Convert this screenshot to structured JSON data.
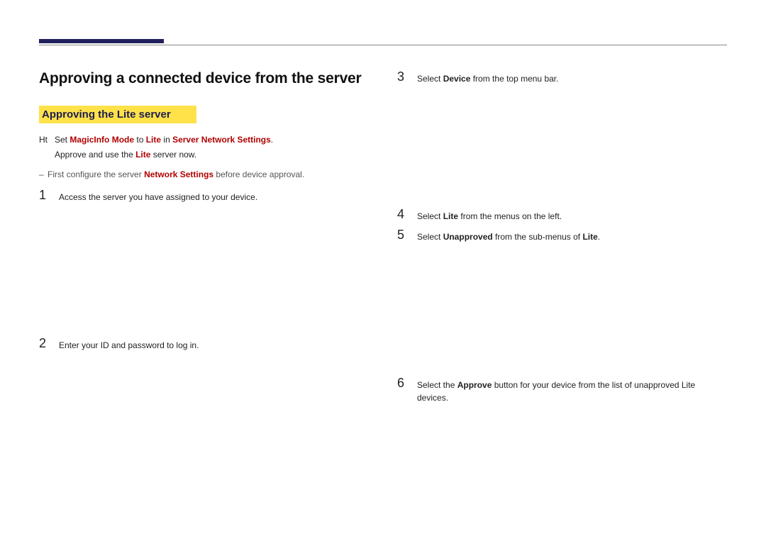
{
  "header": {
    "title": "Approving a connected device from the server"
  },
  "section": {
    "subtitle": "Approving the Lite server"
  },
  "intro": {
    "marker": "Ht",
    "line1_pre": "Set ",
    "line1_em1": "MagicInfo Mode",
    "line1_mid1": " to ",
    "line1_em2": "Lite",
    "line1_mid2": " in ",
    "line1_em3": "Server Network Settings",
    "line1_post": ".",
    "line2_pre": "Approve and use the ",
    "line2_em": "Lite",
    "line2_post": " server now."
  },
  "dash": {
    "pre": "First configure the server ",
    "em": "Network Settings",
    "post": " before device approval."
  },
  "left_steps": {
    "s1_num": "1",
    "s1_text": "Access the server you have assigned to your device.",
    "s2_num": "2",
    "s2_text": "Enter your ID and password to log in."
  },
  "right_steps": {
    "s3_num": "3",
    "s3_pre": "Select ",
    "s3_em": "Device",
    "s3_post": " from the top menu bar.",
    "s4_num": "4",
    "s4_pre": "Select ",
    "s4_em": "Lite",
    "s4_post": " from the menus on the left.",
    "s5_num": "5",
    "s5_pre": "Select ",
    "s5_em": "Unapproved",
    "s5_mid": " from the sub-menus of ",
    "s5_em2": "Lite",
    "s5_post": ".",
    "s6_num": "6",
    "s6_pre": "Select the ",
    "s6_em": "Approve",
    "s6_post": " button for your device from the list of unapproved Lite devices."
  }
}
